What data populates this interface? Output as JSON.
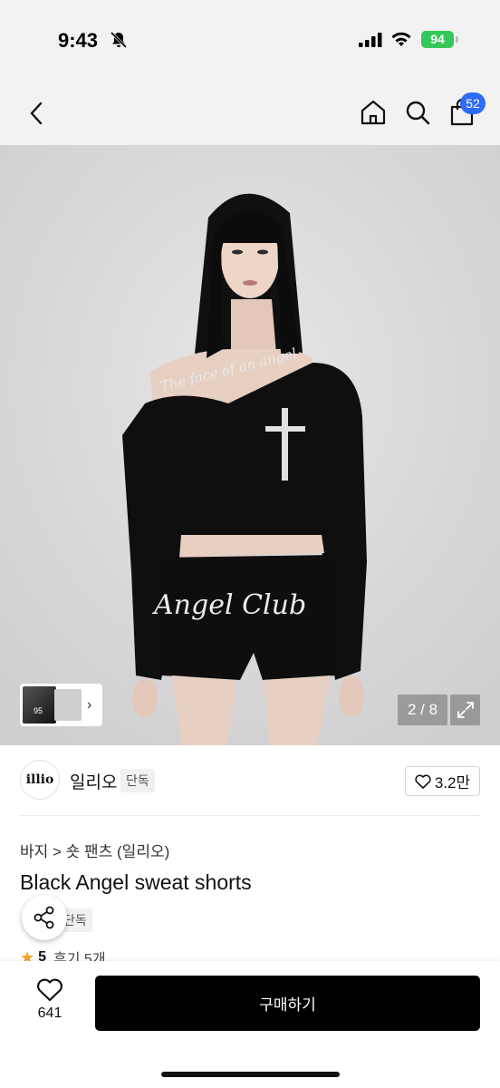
{
  "status_bar": {
    "time": "9:43",
    "battery": "94"
  },
  "nav": {
    "cart_count": "52"
  },
  "gallery": {
    "page_indicator": "2 / 8",
    "print_top": "The face of an angel",
    "print_bottom": "Angel Club",
    "thumb_label": "95"
  },
  "brand": {
    "logo_text": "illio",
    "name": "일리오",
    "badge": "단독",
    "like_count": "3.2만"
  },
  "product": {
    "breadcrumb": "바지 > 숏 팬츠 (일리오)",
    "title": "Black Angel sweat shorts",
    "badge": "단독",
    "rating": "5",
    "reviews": "후기 5개"
  },
  "bottom_bar": {
    "wish_count": "641",
    "buy_label": "구매하기"
  },
  "colors": {
    "accent_badge": "#2f6cf6",
    "battery": "#34c759",
    "star": "#f5a623",
    "buy_button": "#000000"
  },
  "icons": [
    "chevron-left-icon",
    "home-icon",
    "search-icon",
    "bag-icon",
    "expand-icon",
    "heart-icon",
    "share-icon",
    "star-icon",
    "bell-off-icon",
    "signal-icon",
    "wifi-icon"
  ]
}
